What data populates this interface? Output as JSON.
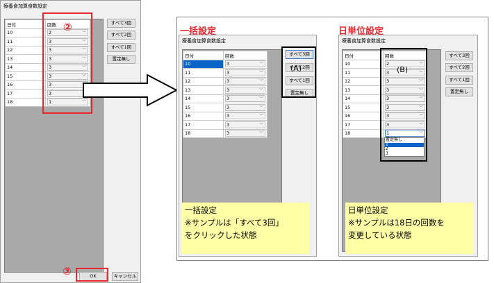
{
  "dialog_title": "療養食加算食数設定",
  "grid_header": {
    "date": "日付",
    "count": "回数"
  },
  "buttons": {
    "all3": "すべて3回",
    "all2": "すべて2回",
    "all1": "すべて1回",
    "none": "置定無し",
    "ok": "OK",
    "cancel": "キャンセル"
  },
  "dropdown_chevron": "﹀",
  "left_rows": [
    {
      "date": "10",
      "count": "2"
    },
    {
      "date": "11",
      "count": "3"
    },
    {
      "date": "12",
      "count": "3"
    },
    {
      "date": "13",
      "count": "3"
    },
    {
      "date": "14",
      "count": "3"
    },
    {
      "date": "15",
      "count": "3"
    },
    {
      "date": "16",
      "count": "3"
    },
    {
      "date": "17",
      "count": "3"
    },
    {
      "date": "18",
      "count": "1"
    }
  ],
  "mid_rows": [
    {
      "date": "10",
      "count": "3"
    },
    {
      "date": "11",
      "count": "3"
    },
    {
      "date": "12",
      "count": "3"
    },
    {
      "date": "13",
      "count": "3"
    },
    {
      "date": "14",
      "count": "3"
    },
    {
      "date": "15",
      "count": "3"
    },
    {
      "date": "16",
      "count": "3"
    },
    {
      "date": "17",
      "count": "3"
    },
    {
      "date": "18",
      "count": "3"
    }
  ],
  "right_rows": [
    {
      "date": "10",
      "count": "2"
    },
    {
      "date": "11",
      "count": "3"
    },
    {
      "date": "12",
      "count": "3"
    },
    {
      "date": "13",
      "count": "3"
    },
    {
      "date": "14",
      "count": "3"
    },
    {
      "date": "15",
      "count": "3"
    },
    {
      "date": "16",
      "count": "3"
    },
    {
      "date": "17",
      "count": "3"
    },
    {
      "date": "18",
      "count": "1"
    }
  ],
  "dropdown_options": [
    "置定無し",
    "1",
    "2",
    "3"
  ],
  "dropdown_selected_index": 1,
  "annotations": {
    "marker2": "②",
    "marker3": "③",
    "markerA": "(A)",
    "markerB": "(B)",
    "heading_bulk": "一括設定",
    "heading_daily": "日単位設定",
    "note_bulk": [
      "一括設定",
      "※サンプルは「すべて3回」",
      "をクリックした状態"
    ],
    "note_daily": [
      "日単位設定",
      "※サンプルは18日の回数を",
      "変更している状態"
    ]
  },
  "colors": {
    "annotation_red": "#e8262d",
    "note_yellow": "#ffffa6",
    "grid_gray": "#a9a9a9",
    "selection_blue": "#0a64c8"
  }
}
